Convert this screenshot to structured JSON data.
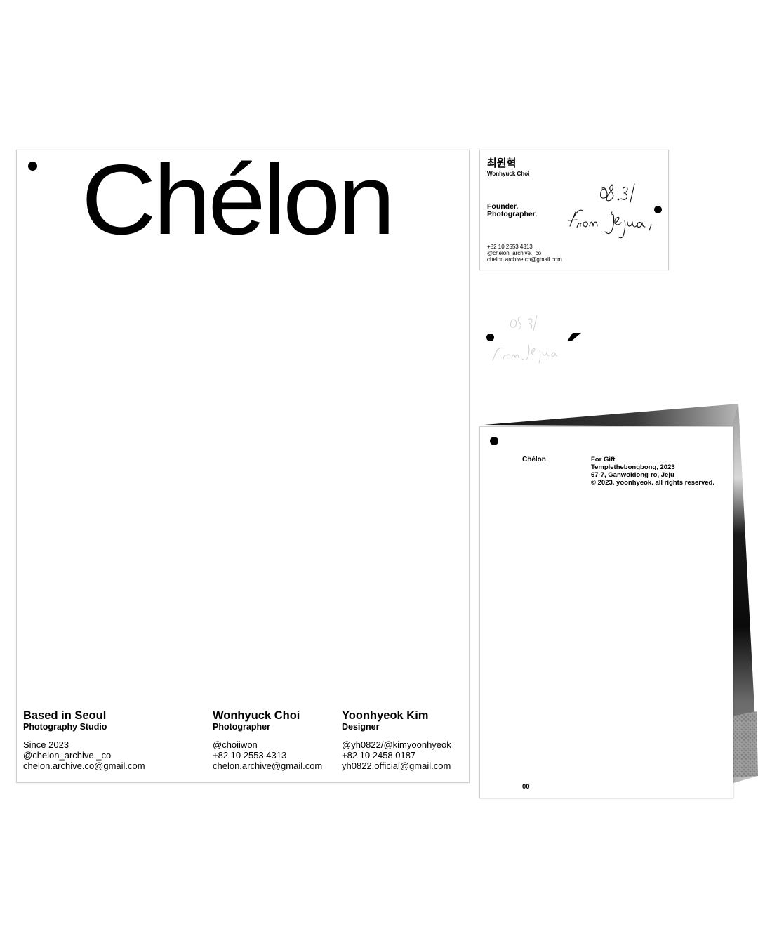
{
  "letterhead": {
    "wordmark": "Chélon",
    "columns": [
      {
        "heading": "Based in Seoul",
        "subheading": "Photography Studio",
        "lines": [
          "Since 2023",
          "@chelon_archive._co",
          "chelon.archive.co@gmail.com"
        ]
      },
      {
        "heading": "Wonhyuck Choi",
        "subheading": "Photographer",
        "lines": [
          "@choiiwon",
          "+82 10 2553 4313",
          "chelon.archive@gmail.com"
        ]
      },
      {
        "heading": "Yoonhyeok Kim",
        "subheading": "Designer",
        "lines": [
          "@yh0822/@kimyoonhyeok",
          "+82 10 2458 0187",
          "yh0822.official@gmail.com"
        ]
      }
    ]
  },
  "card": {
    "name_kr": "최원혁",
    "name_en": "Wonhyuck Choi",
    "roles": [
      "Founder.",
      "Photographer."
    ],
    "contact": [
      "+82 10 2553 4313",
      "@chelon_archive._co",
      "chelon.archive.co@gmail.com"
    ],
    "signature": "08.31 from Jeju,"
  },
  "booklet": {
    "brand": "Chélon",
    "info": [
      "For Gift",
      "Templethebongbong, 2023",
      "67-7, Ganwoldong-ro, Jeju",
      "© 2023. yoonhyeok. all rights reserved."
    ],
    "page_number": "00"
  }
}
